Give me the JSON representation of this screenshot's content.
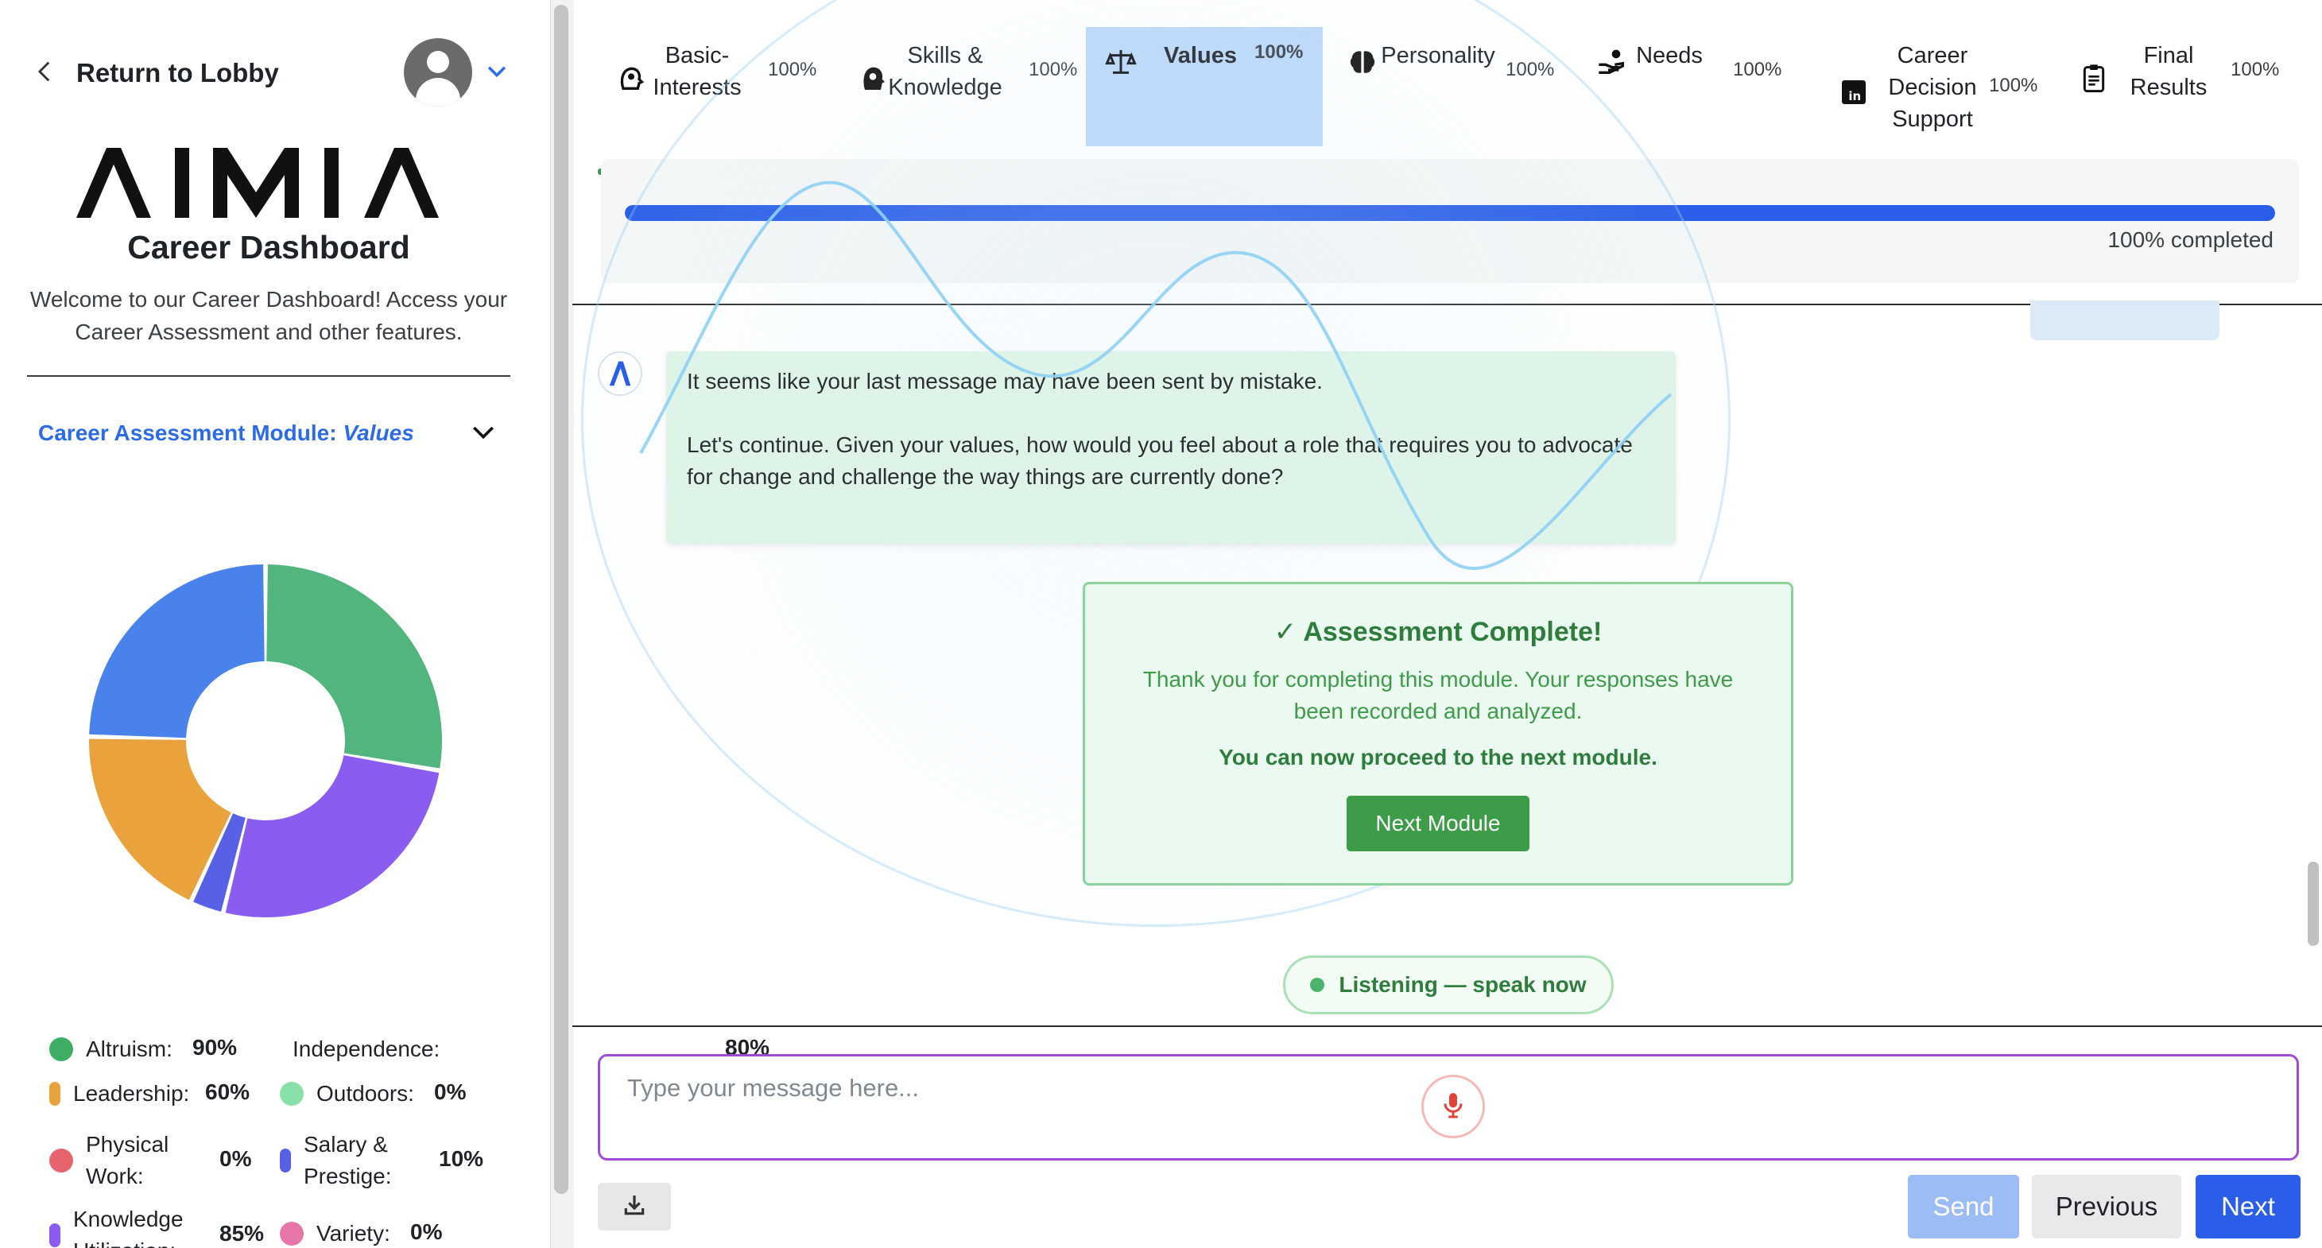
{
  "sidebar": {
    "back_label": "Return to Lobby",
    "logo_text": "AIMIA",
    "title": "Career Dashboard",
    "subtitle": "Welcome to our Career Dashboard! Access your Career Assessment and other features.",
    "module_label": "Career Assessment Module:",
    "module_value": "Values",
    "donut": [
      {
        "name": "Altruism",
        "value": 90,
        "color": "#52b57d"
      },
      {
        "name": "Knowledge Utilization",
        "value": 85,
        "color": "#8b5cf0"
      },
      {
        "name": "Salary & Prestige",
        "value": 10,
        "color": "#5860e6"
      },
      {
        "name": "Leadership",
        "value": 60,
        "color": "#eaa23c"
      },
      {
        "name": "Independence",
        "value": 80,
        "color": "#4a82ec"
      }
    ],
    "legend": [
      {
        "name": "Altruism:",
        "pct": "90%",
        "color": "#3fae64"
      },
      {
        "name": "Independence:",
        "pct": "80%",
        "color": "#4a82ec"
      },
      {
        "name": "Leadership:",
        "pct": "60%",
        "color": "#eaa23c"
      },
      {
        "name": "Outdoors:",
        "pct": "0%",
        "color": "#86e0a8"
      },
      {
        "name": "Physical Work:",
        "pct": "0%",
        "color": "#e5646d"
      },
      {
        "name": "Salary & Prestige:",
        "pct": "10%",
        "color": "#5860e6"
      },
      {
        "name": "Knowledge Utilization:",
        "pct": "85%",
        "color": "#8b5cf0"
      },
      {
        "name": "Variety:",
        "pct": "0%",
        "color": "#e776a8"
      }
    ]
  },
  "tabs": [
    {
      "label": "Basic-Interests",
      "label_lines": [
        "Basic-",
        "Interests"
      ],
      "pct": "100%",
      "icon": "brain-head-icon"
    },
    {
      "label": "Skills & Knowledge",
      "label_lines": [
        "Skills &",
        "Knowledge"
      ],
      "pct": "100%",
      "icon": "head-gears-icon"
    },
    {
      "label": "Values",
      "label_lines": [
        "Values"
      ],
      "pct": "100%",
      "icon": "scales-icon",
      "active": true
    },
    {
      "label": "Personality",
      "label_lines": [
        "Personality"
      ],
      "pct": "100%",
      "icon": "brain-icon"
    },
    {
      "label": "Needs",
      "label_lines": [
        "Needs"
      ],
      "pct": "100%",
      "icon": "hand-coin-icon"
    },
    {
      "label": "Career Decision Support",
      "label_lines": [
        "Career",
        "Decision",
        "Support"
      ],
      "pct": "100%",
      "icon": "linkedin-icon"
    },
    {
      "label": "Final Results",
      "label_lines": [
        "Final",
        "Results"
      ],
      "pct": "100%",
      "icon": "clipboard-icon"
    }
  ],
  "progress": {
    "value": 1.0,
    "text": "100% completed"
  },
  "chat": {
    "bot_message_1": "It seems like your last message may have been sent by mistake.",
    "bot_message_2": "Let's continue. Given your values, how would you feel about a role that requires you to advocate for change and challenge the way things are currently done?"
  },
  "complete": {
    "title": "✓ Assessment Complete!",
    "body": "Thank you for completing this module. Your responses have been recorded and analyzed.",
    "proceed": "You can now proceed to the next module.",
    "button": "Next Module"
  },
  "listening": "Listening — speak now",
  "input": {
    "placeholder": "Type your message here..."
  },
  "buttons": {
    "send": "Send",
    "previous": "Previous",
    "next": "Next"
  },
  "colors": {
    "accent": "#2a5ee8",
    "success": "#3f9a4a",
    "input_border": "#a04bd8"
  }
}
